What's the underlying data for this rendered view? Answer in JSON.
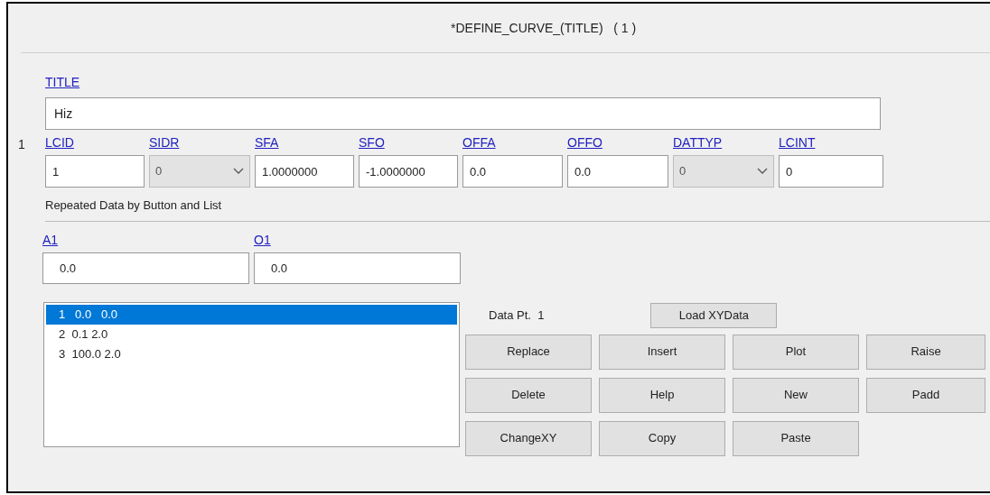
{
  "window": {
    "title": "*DEFINE_CURVE_(TITLE)   ( 1 )"
  },
  "title_field": {
    "label": "TITLE",
    "value": "Hiz"
  },
  "card": {
    "number": "1",
    "fields": [
      {
        "label": "LCID",
        "kind": "input",
        "value": "1"
      },
      {
        "label": "SIDR",
        "kind": "select",
        "value": "0"
      },
      {
        "label": "SFA",
        "kind": "input",
        "value": "1.0000000"
      },
      {
        "label": "SFO",
        "kind": "input",
        "value": "-1.0000000"
      },
      {
        "label": "OFFA",
        "kind": "input",
        "value": "0.0"
      },
      {
        "label": "OFFO",
        "kind": "input",
        "value": "0.0"
      },
      {
        "label": "DATTYP",
        "kind": "select",
        "value": "0"
      },
      {
        "label": "LCINT",
        "kind": "input",
        "value": "0"
      }
    ]
  },
  "repeated": {
    "heading": "Repeated Data by Button and List",
    "fields": [
      {
        "label": "A1",
        "value": "0.0"
      },
      {
        "label": "O1",
        "value": "0.0"
      }
    ],
    "list": [
      {
        "text": "1   0.0   0.0",
        "selected": true
      },
      {
        "text": "2  0.1 2.0",
        "selected": false
      },
      {
        "text": "3  100.0 2.0",
        "selected": false
      }
    ],
    "data_point": {
      "label": "Data Pt.",
      "value": "1"
    },
    "load_button": "Load XYData",
    "buttons": [
      [
        "Replace",
        "Insert",
        "Plot",
        "Raise"
      ],
      [
        "Delete",
        "Help",
        "New",
        "Padd"
      ],
      [
        "ChangeXY",
        "Copy",
        "Paste"
      ]
    ]
  }
}
